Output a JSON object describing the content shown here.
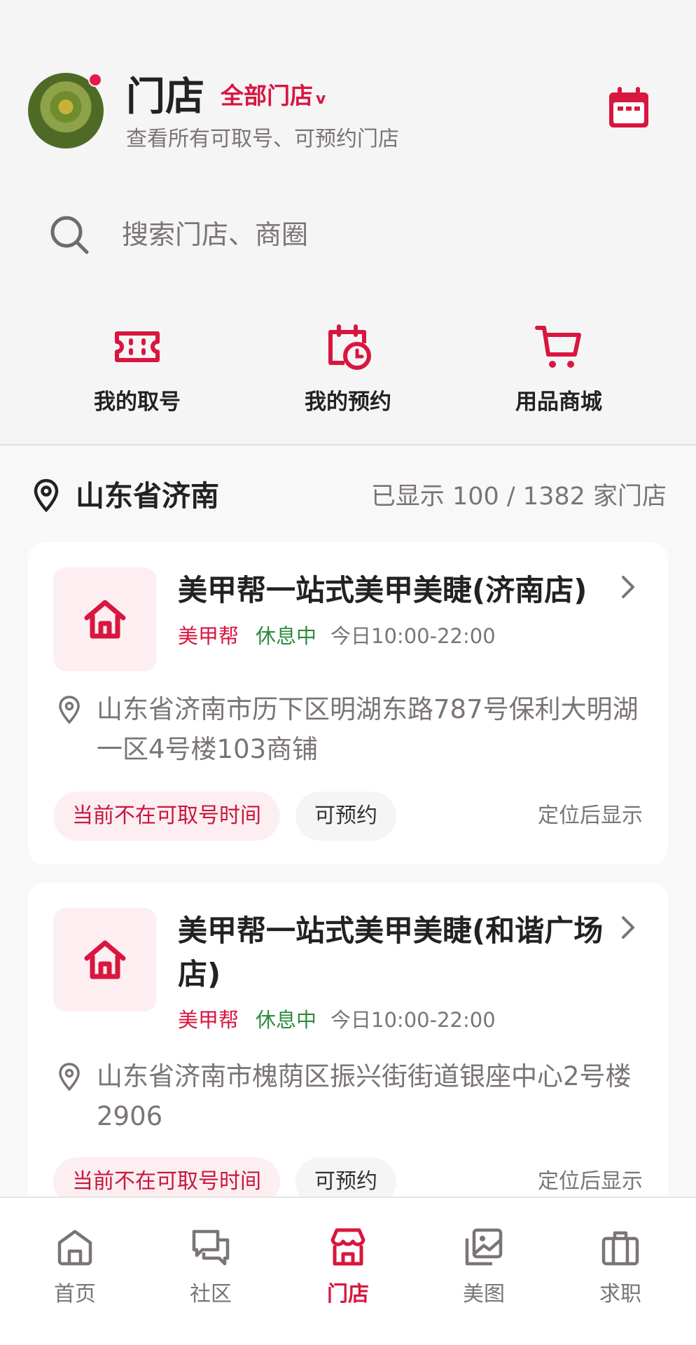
{
  "header": {
    "title": "门店",
    "store_filter": "全部门店",
    "subtitle": "查看所有可取号、可预约门店",
    "calendar_icon": "calendar-icon"
  },
  "search": {
    "placeholder": "搜索门店、商圈"
  },
  "quick_actions": [
    {
      "label": "我的取号",
      "icon": "ticket-icon"
    },
    {
      "label": "我的预约",
      "icon": "calendar-clock-icon"
    },
    {
      "label": "用品商城",
      "icon": "cart-icon"
    }
  ],
  "location": {
    "city": "山东省济南",
    "count_text": "已显示 100 / 1382 家门店"
  },
  "stores": [
    {
      "name": "美甲帮一站式美甲美睫(济南店)",
      "brand": "美甲帮",
      "status": "休息中",
      "hours": "今日10:00-22:00",
      "address": "山东省济南市历下区明湖东路787号保利大明湖一区4号楼103商铺",
      "queue_tag": "当前不在可取号时间",
      "reserve_tag": "可预约",
      "distance": "定位后显示"
    },
    {
      "name": "美甲帮一站式美甲美睫(和谐广场店)",
      "brand": "美甲帮",
      "status": "休息中",
      "hours": "今日10:00-22:00",
      "address": "山东省济南市槐荫区振兴街街道银座中心2号楼2906",
      "queue_tag": "当前不在可取号时间",
      "reserve_tag": "可预约",
      "distance": "定位后显示"
    }
  ],
  "bottom_nav": [
    {
      "label": "首页",
      "icon": "home-icon",
      "active": false
    },
    {
      "label": "社区",
      "icon": "chat-icon",
      "active": false
    },
    {
      "label": "门店",
      "icon": "store-icon",
      "active": true
    },
    {
      "label": "美图",
      "icon": "gallery-icon",
      "active": false
    },
    {
      "label": "求职",
      "icon": "briefcase-icon",
      "active": false
    }
  ],
  "colors": {
    "accent": "#d9163f",
    "open_status": "#2e8b3e",
    "muted_text": "#7a7478",
    "page_bg": "#f6f5f6"
  }
}
